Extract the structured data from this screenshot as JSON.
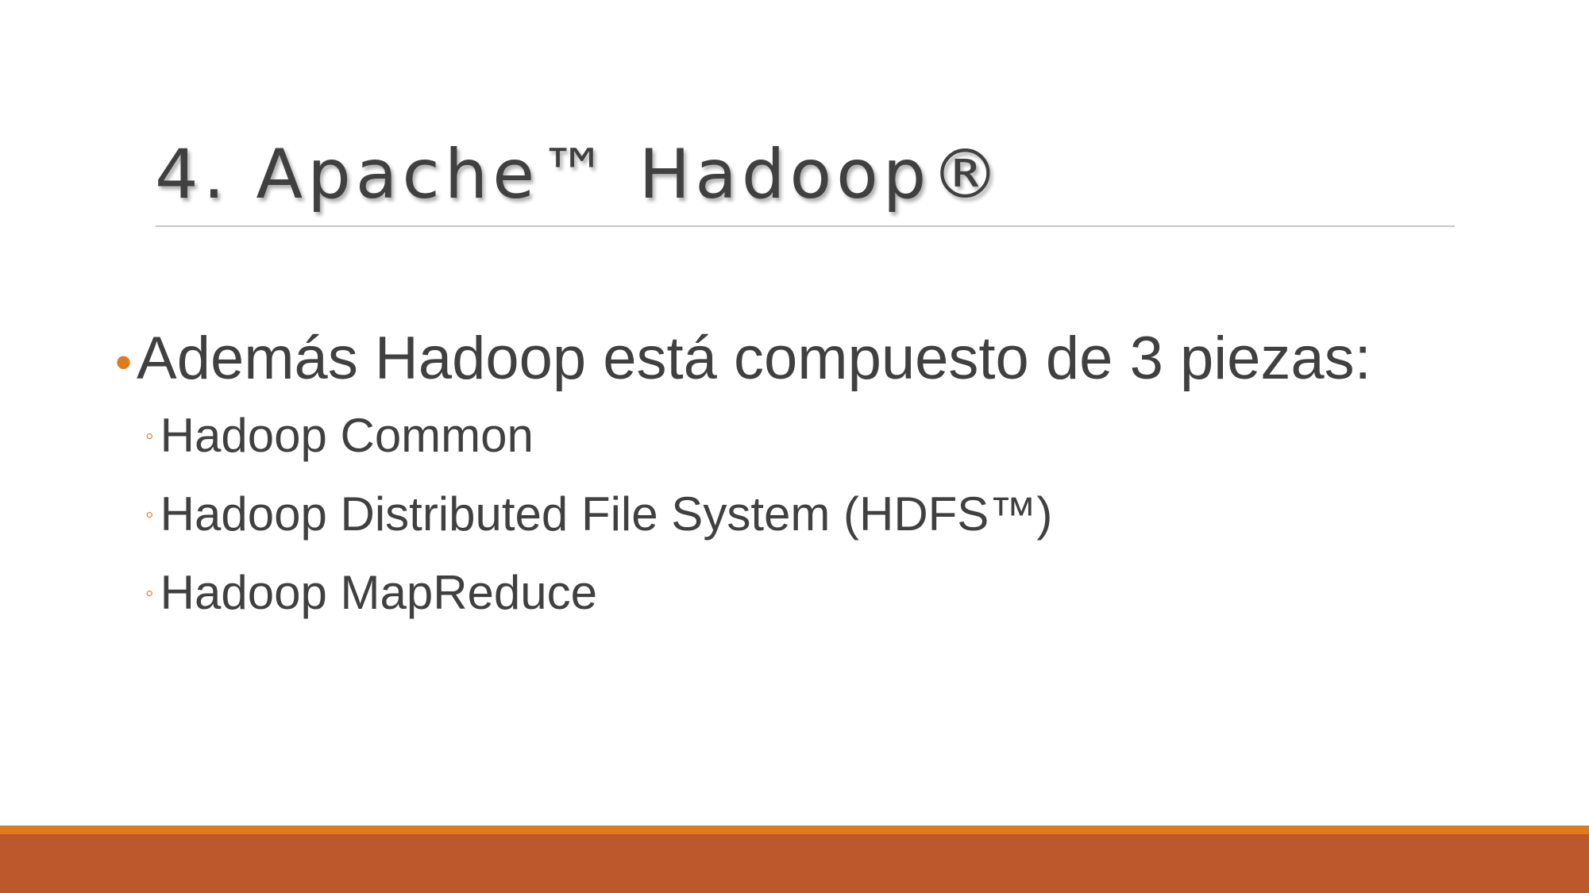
{
  "slide": {
    "title": "4. Apache™ Hadoop®",
    "main_bullet": "Además Hadoop está compuesto de 3 piezas:",
    "main_bullet_marker": "•",
    "sub_bullet_marker": "◦",
    "sub_bullets": [
      {
        "label": "Hadoop Common"
      },
      {
        "label": "Hadoop Distributed File System (HDFS™)"
      },
      {
        "label": "Hadoop MapReduce"
      }
    ]
  },
  "colors": {
    "text": "#404040",
    "accent_orange": "#e07a1f",
    "footer_rust": "#bd582c",
    "rule": "#c8c8c8"
  }
}
